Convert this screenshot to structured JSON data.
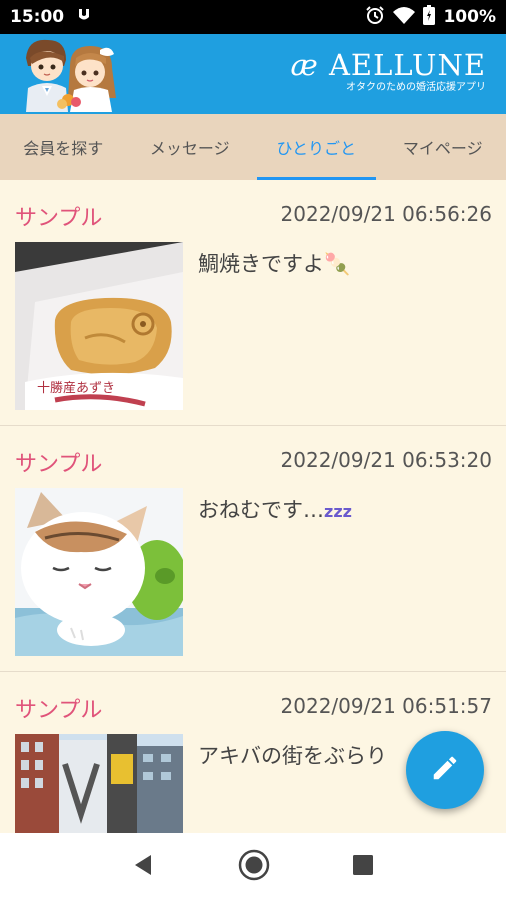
{
  "status": {
    "time": "15:00",
    "battery": "100%",
    "icons": [
      "notification-icon",
      "alarm-icon",
      "wifi-icon",
      "battery-icon"
    ]
  },
  "header": {
    "brand_name": "AELLUNE",
    "brand_mark": "æ",
    "brand_tagline": "オタクのための婚活応援アプリ",
    "color": "#1f9fe0"
  },
  "tabs": [
    {
      "label": "会員を探す",
      "active": false
    },
    {
      "label": "メッセージ",
      "active": false
    },
    {
      "label": "ひとりごと",
      "active": true
    },
    {
      "label": "マイページ",
      "active": false
    }
  ],
  "posts": [
    {
      "user": "サンプル",
      "timestamp": "2022/09/21 06:56:26",
      "text": "鯛焼きですよ🍡",
      "photo": "taiyaki-photo"
    },
    {
      "user": "サンプル",
      "timestamp": "2022/09/21 06:53:20",
      "text": "おねむです…",
      "zzz": "zzz",
      "photo": "cat-photo"
    },
    {
      "user": "サンプル",
      "timestamp": "2022/09/21 06:51:57",
      "text": "アキバの街をぶらり",
      "photo": "city-photo"
    }
  ],
  "fab": {
    "icon": "pencil-icon"
  },
  "colors": {
    "accent": "#2196f3",
    "username": "#e0537a",
    "background": "#fdf6e3",
    "tabbar": "#e9d5bd"
  }
}
